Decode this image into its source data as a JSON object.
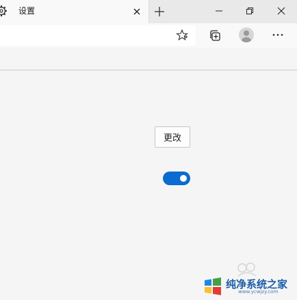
{
  "tab": {
    "title": "设置",
    "icon": "gear-icon"
  },
  "toolbar": {
    "icons": [
      "favorite-star-icon",
      "collections-icon",
      "profile-avatar-icon",
      "more-icon"
    ]
  },
  "window_controls": [
    "minimize-icon",
    "restore-icon",
    "close-icon"
  ],
  "content": {
    "change_button_label": "更改",
    "toggle": {
      "state": "on",
      "accent_color": "#0b6bd0"
    }
  },
  "watermark": {
    "title": "纯净系统之家",
    "url": "www.ycwjzy.com"
  }
}
